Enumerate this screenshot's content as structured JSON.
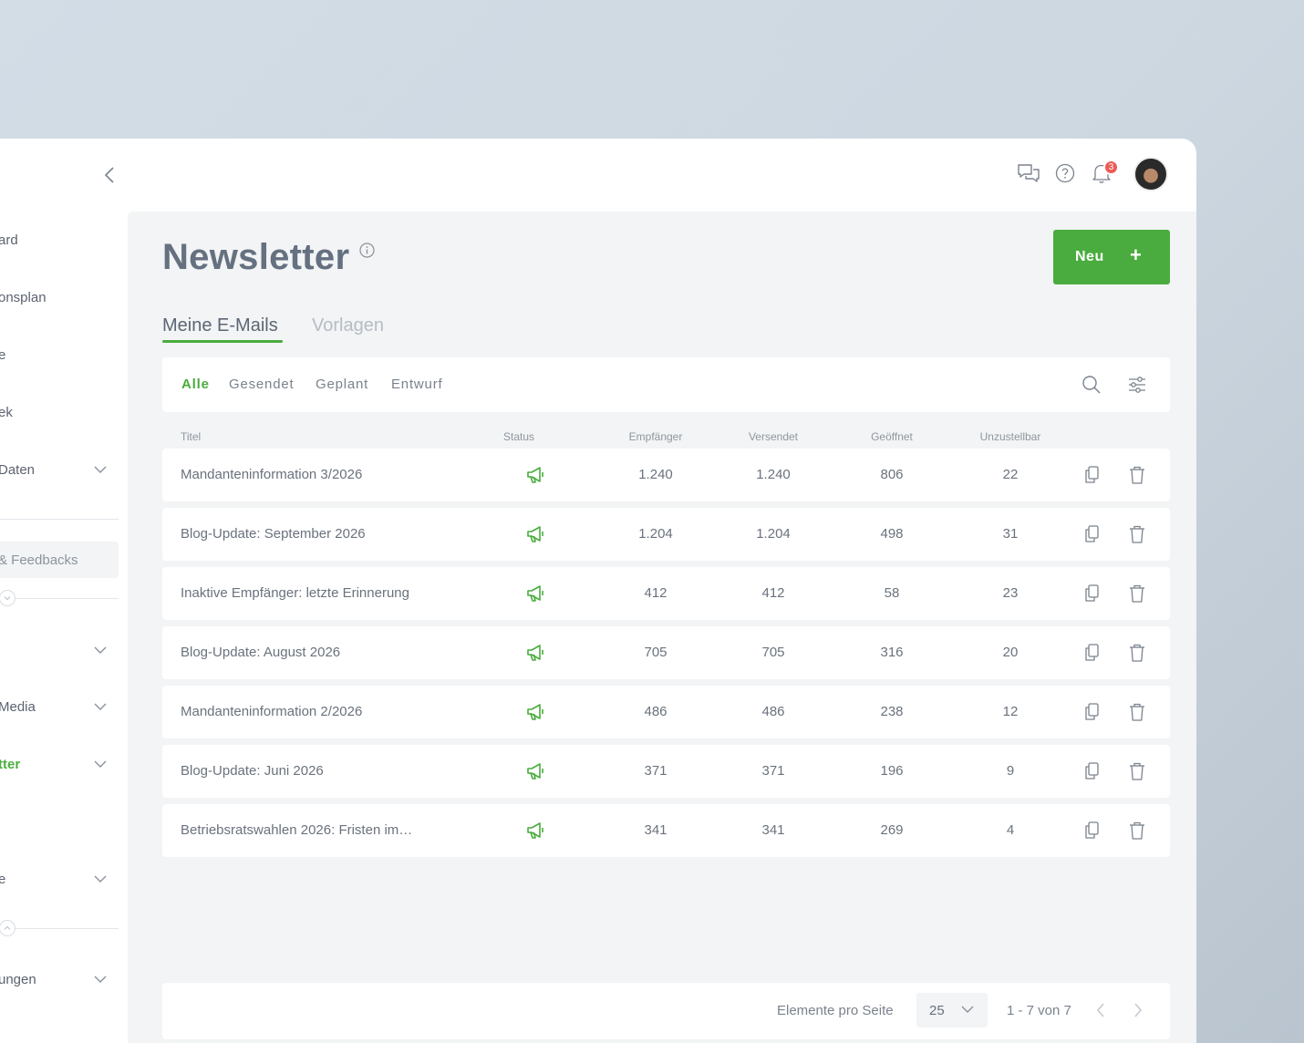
{
  "sidebar": {
    "items": [
      {
        "label": "ard",
        "has_chevron": false,
        "active": false
      },
      {
        "label": "onsplan",
        "has_chevron": false,
        "active": false
      },
      {
        "label": "e",
        "has_chevron": false,
        "active": false
      },
      {
        "label": "ek",
        "has_chevron": false,
        "active": false
      },
      {
        "label": "Daten",
        "has_chevron": true,
        "active": false
      },
      {
        "label": "",
        "has_chevron": true,
        "active": false
      },
      {
        "label": "Media",
        "has_chevron": true,
        "active": false
      },
      {
        "label": "tter",
        "has_chevron": true,
        "active": true
      },
      {
        "label": "e",
        "has_chevron": true,
        "active": false
      },
      {
        "label": "ungen",
        "has_chevron": true,
        "active": false
      }
    ],
    "feedback_label": "& Feedbacks"
  },
  "topbar": {
    "notification_count": "3",
    "icons": [
      "chat-icon",
      "help-icon",
      "bell-icon"
    ]
  },
  "page": {
    "title": "Newsletter",
    "new_button": "Neu",
    "new_button_icon": "+"
  },
  "tabs": [
    {
      "label": "Meine E-Mails",
      "active": true
    },
    {
      "label": "Vorlagen",
      "active": false
    }
  ],
  "filters": [
    {
      "label": "Alle",
      "active": true
    },
    {
      "label": "Gesendet",
      "active": false
    },
    {
      "label": "Geplant",
      "active": false
    },
    {
      "label": "Entwurf",
      "active": false
    }
  ],
  "table": {
    "columns": {
      "title": "Titel",
      "status": "Status",
      "recipients": "Empfänger",
      "sent": "Versendet",
      "opened": "Geöffnet",
      "undeliverable": "Unzustellbar"
    },
    "rows": [
      {
        "title": "Mandanteninformation 3/2026",
        "status": "sent",
        "recipients": "1.240",
        "sent": "1.240",
        "opened": "806",
        "undeliverable": "22"
      },
      {
        "title": "Blog-Update: September 2026",
        "status": "sent",
        "recipients": "1.204",
        "sent": "1.204",
        "opened": "498",
        "undeliverable": "31"
      },
      {
        "title": "Inaktive Empfänger: letzte Erinnerung",
        "status": "sent",
        "recipients": "412",
        "sent": "412",
        "opened": "58",
        "undeliverable": "23"
      },
      {
        "title": "Blog-Update: August 2026",
        "status": "sent",
        "recipients": "705",
        "sent": "705",
        "opened": "316",
        "undeliverable": "20"
      },
      {
        "title": "Mandanteninformation 2/2026",
        "status": "sent",
        "recipients": "486",
        "sent": "486",
        "opened": "238",
        "undeliverable": "12"
      },
      {
        "title": "Blog-Update: Juni 2026",
        "status": "sent",
        "recipients": "371",
        "sent": "371",
        "opened": "196",
        "undeliverable": "9"
      },
      {
        "title": "Betriebsratswahlen 2026: Fristen im…",
        "status": "sent",
        "recipients": "341",
        "sent": "341",
        "opened": "269",
        "undeliverable": "4"
      }
    ]
  },
  "pagination": {
    "per_page_label": "Elemente pro Seite",
    "per_page_value": "25",
    "range": "1 - 7 von 7"
  },
  "colors": {
    "accent": "#4aac3e",
    "badge": "#ec5b56",
    "content_bg": "#f2f4f5"
  }
}
